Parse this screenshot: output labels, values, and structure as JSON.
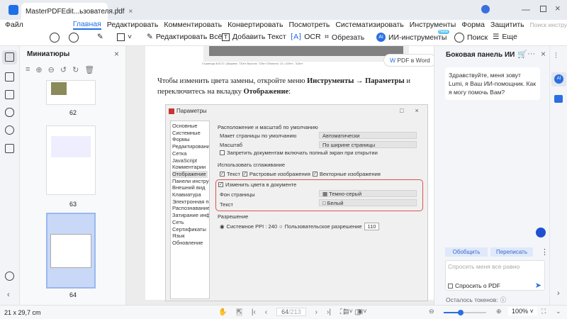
{
  "window": {
    "tab_title": "MasterPDFEdit...ьзователя.pdf",
    "new_tab": "+",
    "close": "×"
  },
  "menu": {
    "file": "Файл",
    "items": [
      "Главная",
      "Редактировать",
      "Комментировать",
      "Конвертировать",
      "Посмотреть",
      "Систематизировать",
      "Инструменты",
      "Форма",
      "Защитить"
    ],
    "search_placeholder": "Поиск инструменте"
  },
  "toolbar": {
    "edit_all": "Редактировать Всё",
    "add_text": "Добавить Текст",
    "ocr": "OCR",
    "crop": "Обрезать",
    "ai_tools": "ИИ-инструменты",
    "new_badge": "New",
    "search": "Поиск",
    "more": "Еще"
  },
  "thumbnails": {
    "title": "Миниатюры",
    "pages": [
      "62",
      "63",
      "64"
    ]
  },
  "document": {
    "pdf_to_word": "PDF в Word",
    "caption": "Страница 40/172 | Ширина: 720пт Высота: 720пт Объекты: 12 | 419пт : 310пт",
    "para_pre": "Чтобы изменить цвета замены, откройте меню ",
    "para_b1": "Инструменты → Параметры",
    "para_mid": " и переключитесь на вкладку ",
    "para_b2": "Отображение",
    "para_end": ":"
  },
  "dialog": {
    "title": "Параметры",
    "categories": [
      "Основные",
      "Системные",
      "Формы",
      "Редактирование",
      "Сетка",
      "JavaScript",
      "Комментарии",
      "Отображение",
      "Панели инструментов",
      "Внешний вид",
      "Клавиатура",
      "Электронная почта",
      "Распознавание текста",
      "Затирание информации",
      "Сеть",
      "Сертификаты",
      "Язык",
      "Обновление"
    ],
    "sec1": "Расположение и масштаб по умолчанию",
    "layout_label": "Макет страницы по умолчанию",
    "layout_value": "Автоматически",
    "zoom_label": "Масштаб",
    "zoom_value": "По ширине страницы",
    "fullscreen": "Запретить документам включать полный экран при открытии",
    "sec2": "Использовать сглаживание",
    "aa_text": "Текст",
    "aa_raster": "Растровые изображения",
    "aa_vector": "Векторные изображения",
    "change_colors": "Изменить цвета в документе",
    "bg_label": "Фон страницы",
    "bg_value": "Темно-серый",
    "text_label": "Текст",
    "text_value": "Белый",
    "sec3": "Разрешение",
    "sys_ppi": "Системное PPI : 240",
    "custom_res": "Пользовательское разрешение",
    "custom_value": "110"
  },
  "ai_panel": {
    "title": "Боковая панель ИИ",
    "greeting": "Здравствуйте, меня зовут Lumi, я Ваш ИИ-помощник. Как я могу помочь Вам?",
    "summarize": "Обобщить",
    "rewrite": "Переписать",
    "input_placeholder": "Спросить меня все равно",
    "ask_pdf": "Спросить о PDF",
    "tokens": "Осталось токенов:"
  },
  "status": {
    "page_size": "21 x 29,7 cm",
    "current_page": "64",
    "total_pages": "/213",
    "zoom": "100%",
    "zoom_slider_percent": 40
  },
  "colors": {
    "accent": "#1f6fe8",
    "highlight": "#d9534f"
  }
}
